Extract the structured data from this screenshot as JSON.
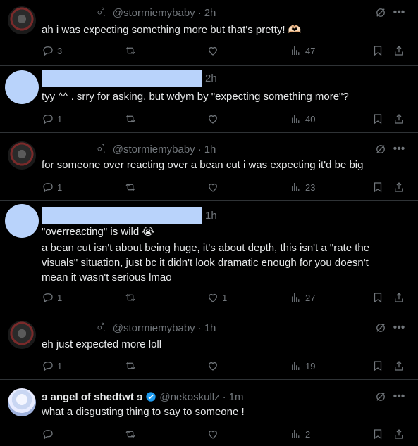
{
  "posts": [
    {
      "handle": "@stormiemybaby",
      "prefix": "⸰̊.",
      "time": "2h",
      "text": "ah i was expecting something more but that's pretty! 🫶🏻",
      "replies": "3",
      "likes": "",
      "views": "47"
    },
    {
      "time": "2h",
      "text": "tyy ^^ . srry for asking, but wdym by \"expecting something more\"?",
      "replies": "1",
      "likes": "",
      "views": "40"
    },
    {
      "handle": "@stormiemybaby",
      "prefix": "⸰̊.",
      "time": "1h",
      "text": "for someone over reacting over a bean cut i was expecting it'd be big",
      "replies": "1",
      "likes": "",
      "views": "23"
    },
    {
      "time": "1h",
      "text_line1": "\"overreacting\" is wild 😭",
      "text_line2": "a bean cut isn't about being huge, it's about depth, this isn't a \"rate the visuals\" situation, just bc it didn't look dramatic enough for you doesn't mean it wasn't serious lmao",
      "replies": "1",
      "likes": "1",
      "views": "27"
    },
    {
      "handle": "@stormiemybaby",
      "prefix": "⸰̊.",
      "time": "1h",
      "text": "eh just expected more loll",
      "replies": "1",
      "likes": "",
      "views": "19"
    },
    {
      "display_name": "ɘ angel of shedtwt ɘ",
      "handle": "@nekoskullz",
      "time": "1m",
      "text": "what a disgusting thing to say to someone !",
      "replies": "",
      "likes": "",
      "views": "2"
    }
  ],
  "icons": {
    "grok": "grok-icon",
    "more": "more-icon",
    "reply": "reply-icon",
    "repost": "repost-icon",
    "like": "like-icon",
    "views": "views-icon",
    "bookmark": "bookmark-icon",
    "share": "share-icon"
  },
  "colors": {
    "background": "#000000",
    "text": "#e7e9ea",
    "muted": "#71767b",
    "redaction": "#b9d3fb",
    "verified": "#1d9bf0"
  }
}
